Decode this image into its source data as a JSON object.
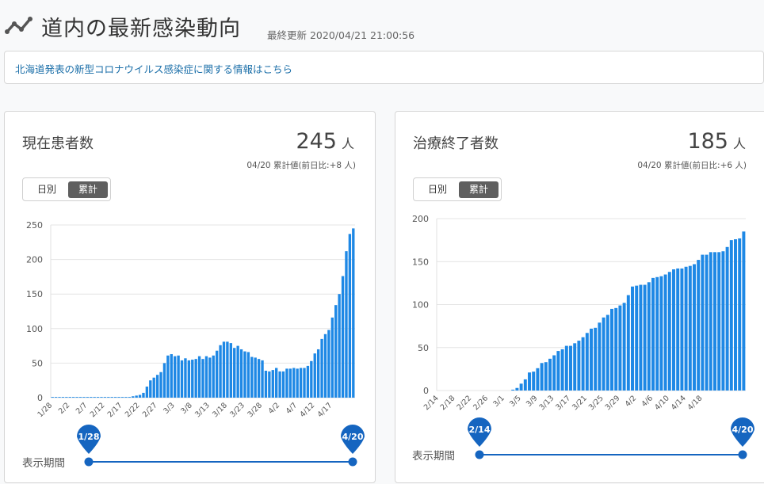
{
  "header": {
    "title": "道内の最新感染動向",
    "updated": "最終更新 2020/04/21 21:00:56",
    "logo_icon": "chart-line-icon"
  },
  "notice": {
    "link_text": "北海道発表の新型コロナウイルス感染症に関する情報はこちら"
  },
  "toggle": {
    "daily": "日別",
    "cumulative": "累計"
  },
  "period_label": "表示期間",
  "colors": {
    "bar": "#1e88e5",
    "slider": "#1565c0",
    "link": "#1a6ea8"
  },
  "cards": [
    {
      "title": "現在患者数",
      "value": "245",
      "unit": "人",
      "sub": "04/20 累計値(前日比:+8 人)",
      "slider_start": "1/28",
      "slider_end": "4/20"
    },
    {
      "title": "治療終了者数",
      "value": "185",
      "unit": "人",
      "sub": "04/20 累計値(前日比:+6 人)",
      "slider_start": "2/14",
      "slider_end": "4/20"
    }
  ],
  "chart_data": [
    {
      "type": "bar",
      "title": "現在患者数",
      "xlabel": "",
      "ylabel": "",
      "ylim": [
        0,
        250
      ],
      "yticks": [
        0,
        50,
        100,
        150,
        200,
        250
      ],
      "tick_labels": [
        "1/28",
        "2/2",
        "2/7",
        "2/12",
        "2/17",
        "2/22",
        "2/27",
        "3/3",
        "3/8",
        "3/13",
        "3/18",
        "3/23",
        "3/28",
        "4/2",
        "4/7",
        "4/12",
        "4/17"
      ],
      "grid": true,
      "values": [
        1,
        1,
        1,
        1,
        1,
        1,
        1,
        1,
        1,
        1,
        1,
        1,
        1,
        1,
        1,
        1,
        1,
        1,
        1,
        1,
        1,
        1,
        1,
        2,
        3,
        4,
        7,
        16,
        25,
        29,
        33,
        37,
        50,
        61,
        63,
        60,
        61,
        54,
        57,
        54,
        55,
        56,
        60,
        56,
        60,
        58,
        61,
        68,
        76,
        81,
        81,
        79,
        72,
        75,
        70,
        67,
        66,
        59,
        58,
        56,
        54,
        39,
        38,
        40,
        43,
        38,
        38,
        42,
        42,
        43,
        42,
        43,
        43,
        46,
        53,
        64,
        70,
        85,
        92,
        98,
        116,
        134,
        150,
        176,
        212,
        237,
        245
      ]
    },
    {
      "type": "bar",
      "title": "治療終了者数",
      "xlabel": "",
      "ylabel": "",
      "ylim": [
        0,
        200
      ],
      "yticks": [
        0,
        50,
        100,
        150,
        200
      ],
      "tick_labels": [
        "2/14",
        "2/18",
        "2/22",
        "2/26",
        "3/1",
        "3/5",
        "3/9",
        "3/13",
        "3/17",
        "3/21",
        "3/25",
        "3/29",
        "4/2",
        "4/6",
        "4/10",
        "4/14",
        "4/18"
      ],
      "grid": true,
      "values": [
        0,
        0,
        0,
        0,
        0,
        0,
        0,
        0,
        0,
        0,
        0,
        0,
        0,
        0,
        0,
        0,
        0,
        0,
        1,
        3,
        8,
        13,
        21,
        22,
        26,
        32,
        33,
        37,
        41,
        46,
        48,
        52,
        52,
        55,
        58,
        62,
        67,
        72,
        73,
        79,
        85,
        88,
        95,
        96,
        99,
        102,
        111,
        121,
        122,
        123,
        123,
        126,
        131,
        132,
        133,
        135,
        138,
        141,
        142,
        142,
        144,
        145,
        147,
        152,
        158,
        158,
        161,
        161,
        161,
        162,
        167,
        175,
        176,
        177,
        185
      ]
    }
  ]
}
